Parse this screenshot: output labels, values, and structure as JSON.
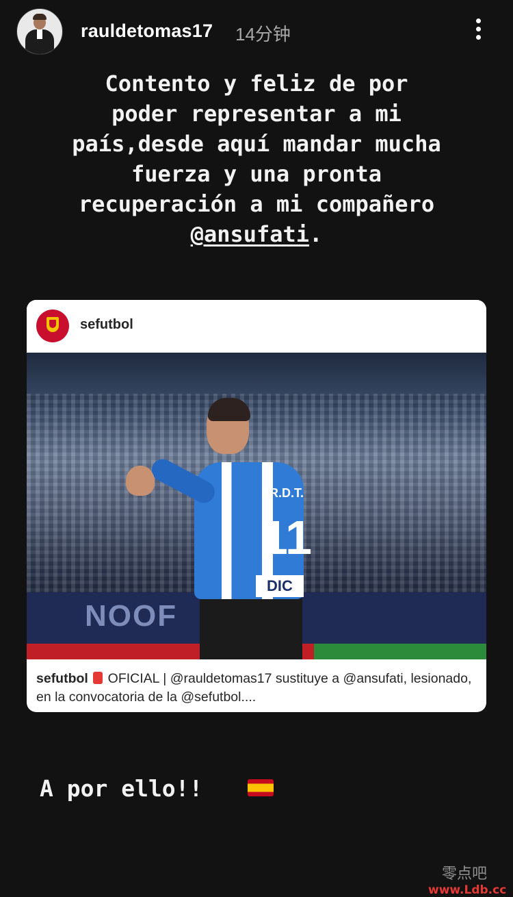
{
  "header": {
    "username": "rauldetomas17",
    "time": "14分钟",
    "more_icon": "more-vertical-icon"
  },
  "caption": {
    "line1": "Contento y feliz de por",
    "line2": "poder representar a mi",
    "line3": "país,desde aquí mandar mucha",
    "line4": "fuerza y una pronta",
    "line5": "recuperación a mi compañero",
    "mention": "@ansufati",
    "mention_suffix": "."
  },
  "shared_post": {
    "account": "sefutbol",
    "photo": {
      "board_text": "NOOF",
      "jersey_number": "11",
      "jersey_name": "R.D.T.",
      "sponsor": "DIC"
    },
    "caption_user": "sefutbol",
    "caption_text": " OFICIAL | @rauldetomas17 sustituye a @ansufati, lesionado, en la convocatoria de la @sefutbol...."
  },
  "footer": {
    "text": "A por ello!!",
    "flag_icon": "spain-flag-icon"
  },
  "watermark": {
    "cn": "零点吧",
    "url": "www.Ldb.cc"
  },
  "colors": {
    "background": "#121212",
    "crest_red": "#c8102e",
    "jersey_blue": "#2f7bd6"
  }
}
